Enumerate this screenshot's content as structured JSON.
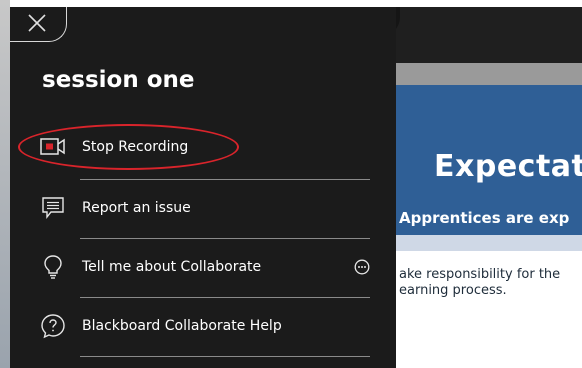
{
  "window": {
    "close_icon": "close-icon"
  },
  "panel": {
    "session_title": "session one",
    "menu_items": [
      {
        "label": "Stop Recording",
        "icon": "record-icon",
        "accent": "#d9242b"
      },
      {
        "label": "Report an issue",
        "icon": "chat-report-icon"
      },
      {
        "label": "Tell me about Collaborate",
        "icon": "lightbulb-icon",
        "more_icon": "more-options-icon"
      },
      {
        "label": "Blackboard Collaborate Help",
        "icon": "help-icon"
      }
    ]
  },
  "slide": {
    "title": "Expectat",
    "subtitle": "Apprentices are exp",
    "body_line1": "ake responsibility for the",
    "body_line2": "earning process."
  },
  "colors": {
    "panel_bg": "#1b1b1b",
    "highlight": "#d9242b",
    "slide_blue": "#2f5f96"
  }
}
